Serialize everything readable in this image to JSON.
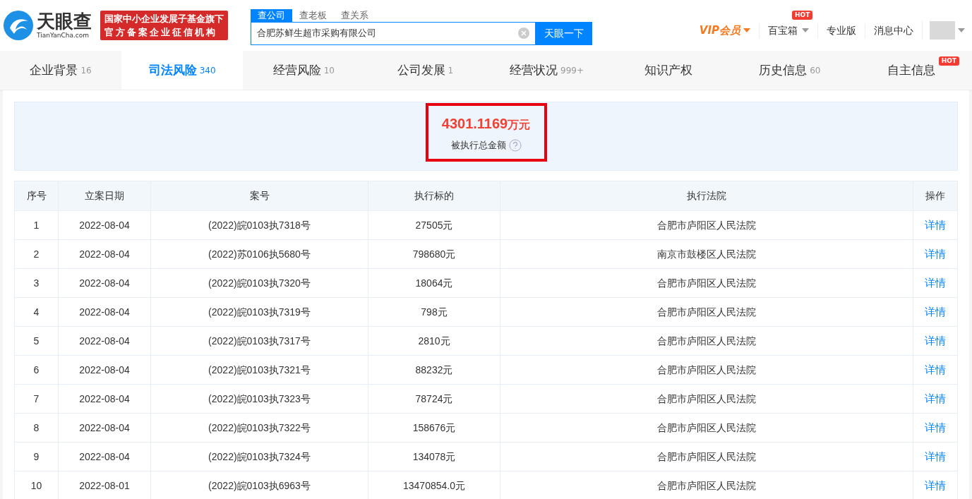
{
  "header": {
    "logo_text": "天眼查",
    "logo_sub": "TianYanCha.com",
    "banner_lines": [
      "国家中小企业发展子基金旗下",
      "官方备案企业征信机构"
    ],
    "search_tabs": [
      {
        "label": "查公司",
        "selected": true
      },
      {
        "label": "查老板",
        "selected": false
      },
      {
        "label": "查关系",
        "selected": false
      }
    ],
    "search": {
      "value": "合肥苏鲜生超市采购有限公司",
      "button": "天眼一下"
    },
    "nav": [
      {
        "label": "VIP会员",
        "kind": "vip"
      },
      {
        "label": "百宝箱",
        "kind": "dropdown",
        "badge": "HOT"
      },
      {
        "label": "专业版",
        "kind": "link"
      },
      {
        "label": "消息中心",
        "kind": "link"
      }
    ]
  },
  "tabs": [
    {
      "label": "企业背景",
      "count": "16",
      "selected": false
    },
    {
      "label": "司法风险",
      "count": "340",
      "selected": true
    },
    {
      "label": "经营风险",
      "count": "10",
      "selected": false
    },
    {
      "label": "公司发展",
      "count": "1",
      "selected": false
    },
    {
      "label": "经营状况",
      "count": "999+",
      "selected": false
    },
    {
      "label": "知识产权",
      "selected": false
    },
    {
      "label": "历史信息",
      "count": "60",
      "selected": false
    },
    {
      "label": "自主信息",
      "badge": "HOT",
      "selected": false
    }
  ],
  "summary": {
    "amount": "4301.1169",
    "unit": "万元",
    "label": "被执行总金额"
  },
  "table": {
    "columns": [
      "序号",
      "立案日期",
      "案号",
      "执行标的",
      "执行法院",
      "操作"
    ],
    "rows": [
      [
        "1",
        "2022-08-04",
        "(2022)皖0103执7318号",
        "27505元",
        "合肥市庐阳区人民法院",
        "详情"
      ],
      [
        "2",
        "2022-08-04",
        "(2022)苏0106执5680号",
        "798680元",
        "南京市鼓楼区人民法院",
        "详情"
      ],
      [
        "3",
        "2022-08-04",
        "(2022)皖0103执7320号",
        "18064元",
        "合肥市庐阳区人民法院",
        "详情"
      ],
      [
        "4",
        "2022-08-04",
        "(2022)皖0103执7319号",
        "798元",
        "合肥市庐阳区人民法院",
        "详情"
      ],
      [
        "5",
        "2022-08-04",
        "(2022)皖0103执7317号",
        "2810元",
        "合肥市庐阳区人民法院",
        "详情"
      ],
      [
        "6",
        "2022-08-04",
        "(2022)皖0103执7321号",
        "88232元",
        "合肥市庐阳区人民法院",
        "详情"
      ],
      [
        "7",
        "2022-08-04",
        "(2022)皖0103执7323号",
        "78724元",
        "合肥市庐阳区人民法院",
        "详情"
      ],
      [
        "8",
        "2022-08-04",
        "(2022)皖0103执7322号",
        "158676元",
        "合肥市庐阳区人民法院",
        "详情"
      ],
      [
        "9",
        "2022-08-04",
        "(2022)皖0103执7324号",
        "134078元",
        "合肥市庐阳区人民法院",
        "详情"
      ],
      [
        "10",
        "2022-08-01",
        "(2022)皖0103执6963号",
        "13470854.0元",
        "合肥市庐阳区人民法院",
        "详情"
      ]
    ]
  }
}
